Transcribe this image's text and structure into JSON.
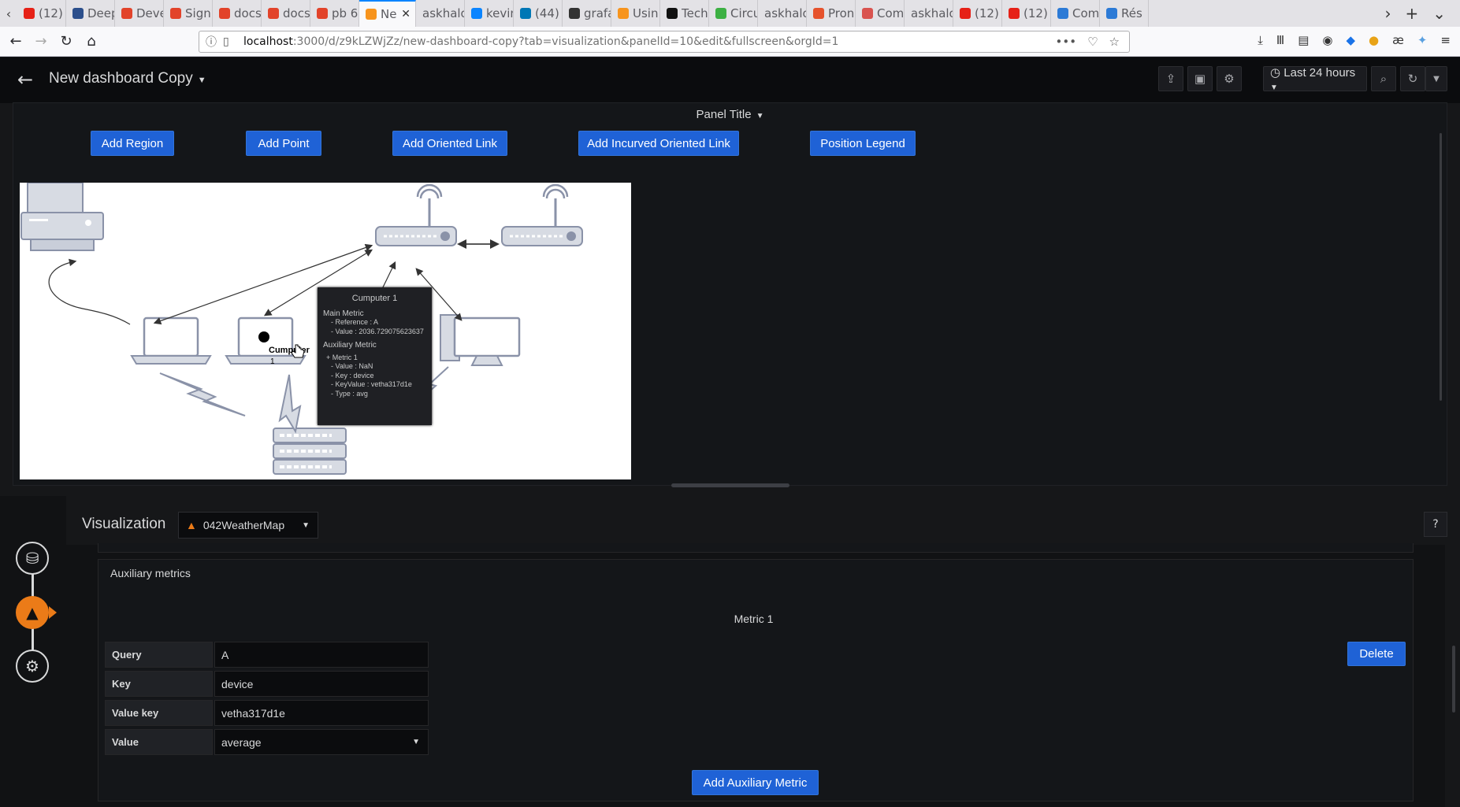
{
  "browser": {
    "tabs": [
      {
        "label": "(12)",
        "color": "#e62117",
        "active": false
      },
      {
        "label": "Deep",
        "color": "#2c4f8c",
        "active": false
      },
      {
        "label": "Deve",
        "color": "#e2432a",
        "active": false
      },
      {
        "label": "Sign",
        "color": "#e2432a",
        "active": false
      },
      {
        "label": "docs",
        "color": "#e2432a",
        "active": false
      },
      {
        "label": "docs",
        "color": "#e2432a",
        "active": false
      },
      {
        "label": "pb 6",
        "color": "#e2432a",
        "active": false
      },
      {
        "label": "Ne",
        "color": "#f7941d",
        "active": true
      },
      {
        "label": "askhalog",
        "color": "",
        "active": false
      },
      {
        "label": "kevin",
        "color": "#0a84ff",
        "active": false
      },
      {
        "label": "(44)",
        "color": "#0077b5",
        "active": false
      },
      {
        "label": "grafa",
        "color": "#333333",
        "active": false
      },
      {
        "label": "Usin",
        "color": "#f7941d",
        "active": false
      },
      {
        "label": "Tech",
        "color": "#111111",
        "active": false
      },
      {
        "label": "Circu",
        "color": "#3cb043",
        "active": false
      },
      {
        "label": "askhalog",
        "color": "",
        "active": false
      },
      {
        "label": "Pron",
        "color": "#e6522c",
        "active": false
      },
      {
        "label": "Com",
        "color": "#d9534f",
        "active": false
      },
      {
        "label": "askhalog",
        "color": "",
        "active": false
      },
      {
        "label": "(12)",
        "color": "#e62117",
        "active": false
      },
      {
        "label": "(12)",
        "color": "#e62117",
        "active": false
      },
      {
        "label": "Com",
        "color": "#2c7ad6",
        "active": false
      },
      {
        "label": "Rés",
        "color": "#2c7ad6",
        "active": false
      }
    ],
    "url_host": "localhost",
    "url_path": ":3000/d/z9kLZWjZz/new-dashboard-copy?tab=visualization&panelId=10&edit&fullscreen&orgId=1"
  },
  "dashboard": {
    "title": "New dashboard Copy",
    "time_range": "Last 24 hours"
  },
  "panel": {
    "title": "Panel Title",
    "buttons": {
      "add_region": "Add Region",
      "add_point": "Add Point",
      "add_oriented_link": "Add Oriented Link",
      "add_incurved_oriented_link": "Add Incurved Oriented Link",
      "position_legend": "Position Legend"
    },
    "map_label_line1": "Cumputer",
    "map_label_line2": "1",
    "tooltip": {
      "title": "Cumputer 1",
      "main_metric": "Main Metric",
      "reference": "- Reference : A",
      "value": "- Value : 2036.729075623637",
      "aux_metric": "Auxiliary Metric",
      "metric_name": "+ Metric 1",
      "aux_value": "- Value : NaN",
      "aux_key": "- Key : device",
      "aux_keyvalue": "- KeyValue : vetha317d1e",
      "aux_type": "- Type : avg"
    }
  },
  "editor": {
    "visualization_label": "Visualization",
    "plugin_name": "042WeatherMap",
    "help": "?",
    "section_title": "Auxiliary metrics",
    "metric_heading": "Metric 1",
    "delete_label": "Delete",
    "add_aux_label": "Add Auxiliary Metric",
    "fields": {
      "query_label": "Query",
      "query_value": "A",
      "key_label": "Key",
      "key_value": "device",
      "value_key_label": "Value key",
      "value_key_value": "vetha317d1e",
      "value_label": "Value",
      "value_value": "average"
    }
  }
}
